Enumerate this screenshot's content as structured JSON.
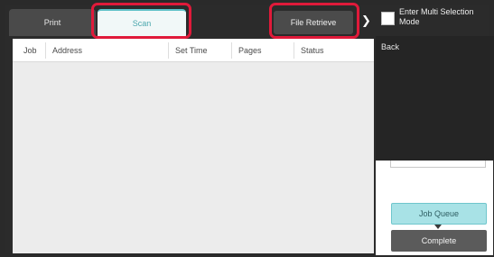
{
  "tabs": {
    "print": "Print",
    "scan": "Scan",
    "file_retrieve": "File Retrieve"
  },
  "multi_select": {
    "label": "Enter Multi Selection Mode",
    "checked": false
  },
  "menu": {
    "back": "Back"
  },
  "table": {
    "columns": [
      "Job",
      "Address",
      "Set Time",
      "Pages",
      "Status"
    ]
  },
  "buttons": {
    "job_queue": "Job Queue",
    "complete": "Complete"
  },
  "colors": {
    "highlight": "#e01a3a",
    "scan_accent": "#5cc1c8",
    "job_queue_bg": "#a8e2e6"
  },
  "icons": {
    "expand": "chevron-right-icon"
  }
}
